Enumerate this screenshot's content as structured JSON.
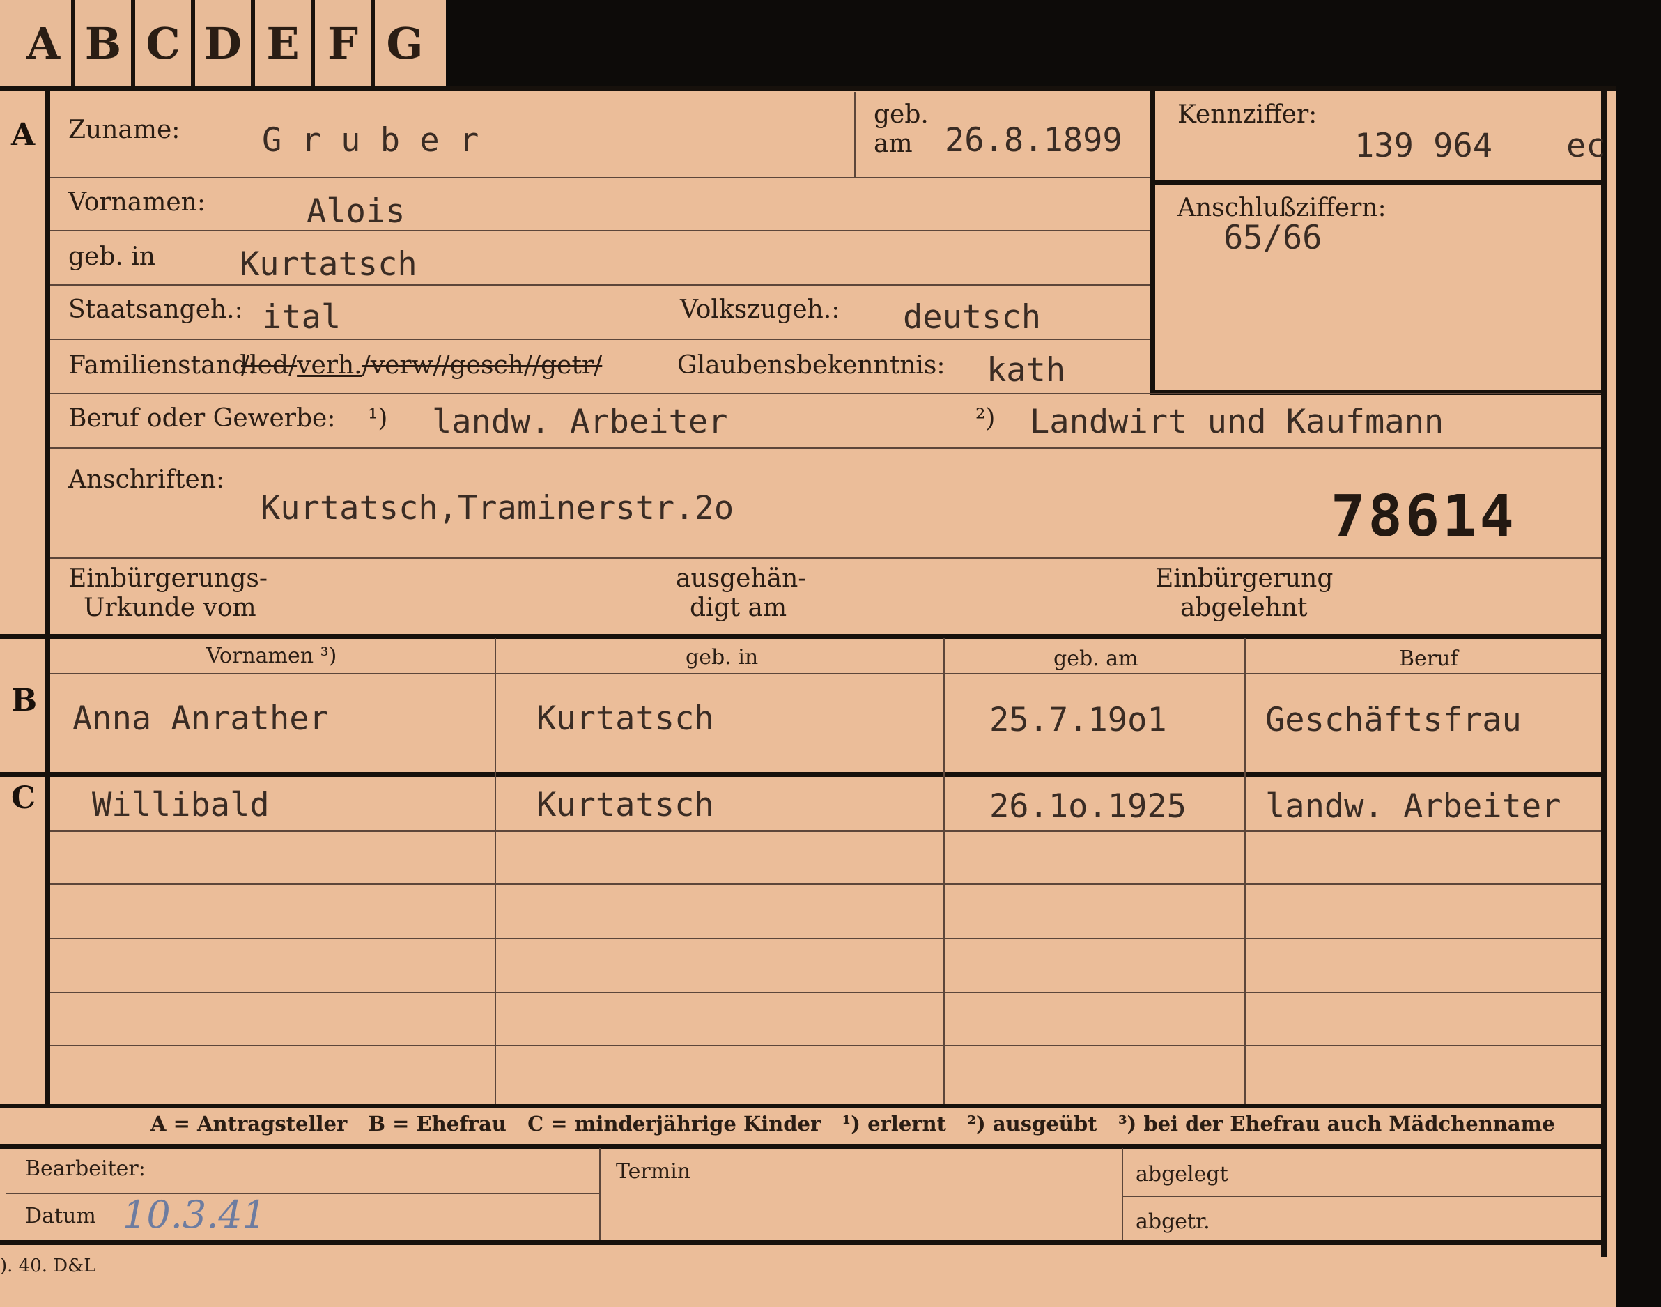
{
  "tabs": [
    "A",
    "B",
    "C",
    "D",
    "E",
    "F",
    "G"
  ],
  "sections": {
    "a": "A",
    "b": "B",
    "c": "C"
  },
  "applicant": {
    "surname_label": "Zuname:",
    "surname": "G r u b e r",
    "geb_label_1": "geb.",
    "geb_label_2": "am",
    "birth_date": "26.8.1899",
    "kennziffer_label": "Kennziffer:",
    "kennziffer": "139 964",
    "kennziffer_suffix": "ec",
    "anschluss_label": "Anschlußziffern:",
    "anschluss": "65/66",
    "vornamen_label": "Vornamen:",
    "vornamen": "Alois",
    "gebin_label": "geb. in",
    "birth_place": "Kurtatsch",
    "staats_label": "Staatsangeh.:",
    "staats": "ital",
    "volks_label": "Volkszugeh.:",
    "volks": "deutsch",
    "familien_label": "Familienstand:",
    "familien_opt1": "/led/",
    "familien_selected": "verh.",
    "familien_opt2": "/verw/",
    "familien_opt3": "/gesch/",
    "familien_opt4": "/getr/",
    "glaube_label": "Glaubensbekenntnis:",
    "glaube": "kath",
    "beruf_label": "Beruf oder Gewerbe:",
    "beruf_mark1": "¹)",
    "beruf1": "landw. Arbeiter",
    "beruf_mark2": "²)",
    "beruf2": "Landwirt und Kaufmann",
    "anschrift_label": "Anschriften:",
    "anschrift": "Kurtatsch,Traminerstr.2o",
    "number_stamp": "78614",
    "einb_label_1": "Einbürgerungs-",
    "einb_label_2": "Urkunde vom",
    "ausg_label_1": "ausgehän-",
    "ausg_label_2": "digt am",
    "abgelehnt_label_1": "Einbürgerung",
    "abgelehnt_label_2": "abgelehnt"
  },
  "table": {
    "headers": [
      "Vornamen ³)",
      "geb. in",
      "geb. am",
      "Beruf"
    ],
    "spouse": {
      "vornamen": "Anna Anrather",
      "geb_in": "Kurtatsch",
      "geb_am": "25.7.19o1",
      "beruf": "Geschäftsfrau"
    },
    "children": [
      {
        "vornamen": "Willibald",
        "geb_in": "Kurtatsch",
        "geb_am": "26.1o.1925",
        "beruf": "landw. Arbeiter"
      }
    ]
  },
  "legend": "A = Antragsteller   B = Ehefrau   C = minderjährige Kinder   ¹) erlernt   ²) ausgeübt   ³) bei der Ehefrau auch Mädchenname",
  "footer": {
    "bearbeiter_label": "Bearbeiter:",
    "datum_label": "Datum",
    "datum_value": "10.3.41",
    "termin_label": "Termin",
    "abgelegt_label": "abgelegt",
    "abgetr_label": "abgetr.",
    "print_mark": "). 40. D&L"
  }
}
